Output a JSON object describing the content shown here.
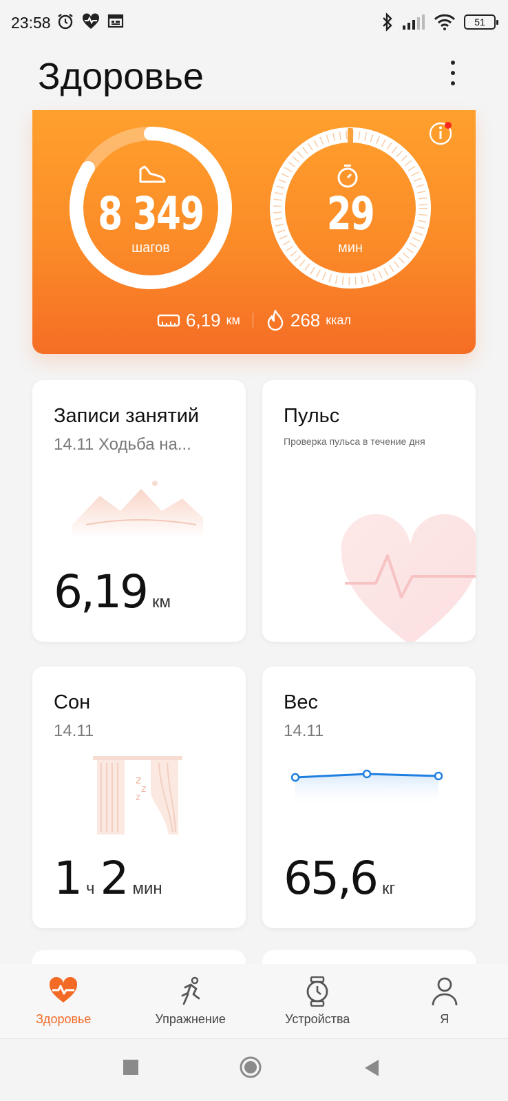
{
  "status_bar": {
    "time": "23:58",
    "battery": "51"
  },
  "header": {
    "title": "Здоровье"
  },
  "activity": {
    "steps_value": "8 349",
    "steps_unit": "шагов",
    "minutes_value": "29",
    "minutes_unit": "мин",
    "distance_value": "6,19",
    "distance_unit": "км",
    "calories_value": "268",
    "calories_unit": "ккал",
    "steps_progress": 0.84,
    "accent_color": "#fb8b28"
  },
  "tiles": {
    "records": {
      "title": "Записи занятий",
      "subtitle": "14.11 Ходьба на...",
      "value": "6,19",
      "unit": "км"
    },
    "pulse": {
      "title": "Пульс",
      "description": "Проверка пульса в течение дня"
    },
    "sleep": {
      "title": "Сон",
      "subtitle": "14.11",
      "hours": "1",
      "hours_unit": "ч",
      "minutes": "2",
      "minutes_unit": "мин"
    },
    "weight": {
      "title": "Вес",
      "subtitle": "14.11",
      "value": "65,6",
      "unit": "кг"
    }
  },
  "bottom_nav": {
    "items": [
      {
        "label": "Здоровье",
        "icon": "heart-pulse-icon",
        "active": true
      },
      {
        "label": "Упражнение",
        "icon": "runner-icon",
        "active": false
      },
      {
        "label": "Устройства",
        "icon": "watch-icon",
        "active": false
      },
      {
        "label": "Я",
        "icon": "person-icon",
        "active": false
      }
    ]
  }
}
